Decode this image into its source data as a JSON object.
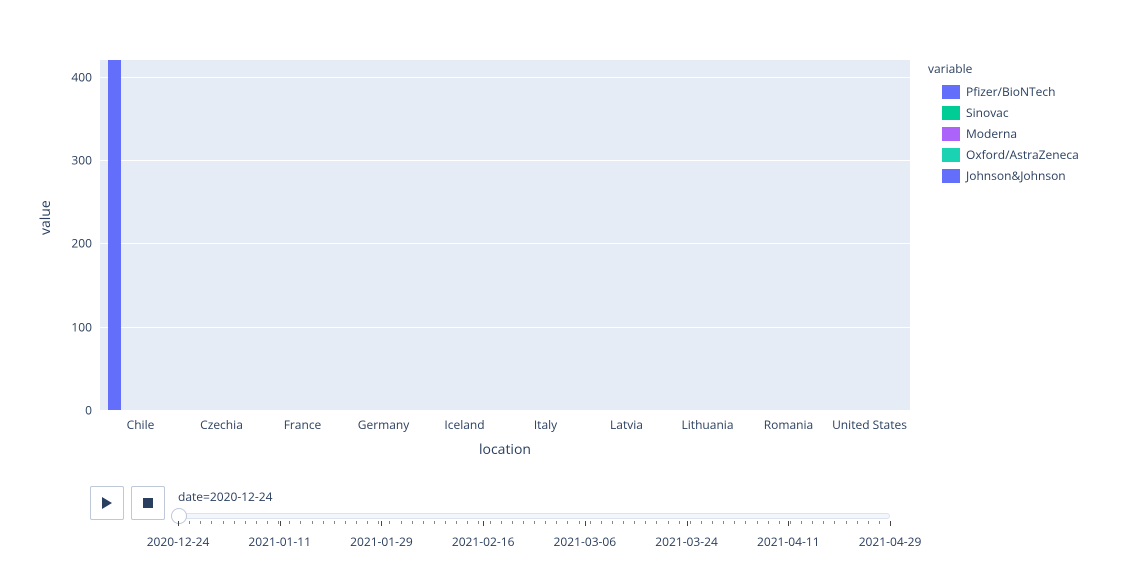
{
  "chart_data": {
    "type": "bar",
    "title": "",
    "xlabel": "location",
    "ylabel": "value",
    "categories": [
      "Chile",
      "Czechia",
      "France",
      "Germany",
      "Iceland",
      "Italy",
      "Latvia",
      "Lithuania",
      "Romania",
      "United States"
    ],
    "series": [
      {
        "name": "Pfizer/BioNTech",
        "values": [
          420,
          0,
          0,
          0,
          0,
          0,
          0,
          0,
          0,
          0
        ],
        "color": "#636efa"
      },
      {
        "name": "Sinovac",
        "values": [
          0,
          0,
          0,
          0,
          0,
          0,
          0,
          0,
          0,
          0
        ],
        "color": "#00cc96"
      },
      {
        "name": "Moderna",
        "values": [
          0,
          0,
          0,
          0,
          0,
          0,
          0,
          0,
          0,
          0
        ],
        "color": "#ab63fa"
      },
      {
        "name": "Oxford/AstraZeneca",
        "values": [
          0,
          0,
          0,
          0,
          0,
          0,
          0,
          0,
          0,
          0
        ],
        "color": "#19d3b3"
      },
      {
        "name": "Johnson&Johnson",
        "values": [
          0,
          0,
          0,
          0,
          0,
          0,
          0,
          0,
          0,
          0
        ],
        "color": "#636efa"
      }
    ],
    "y_ticks": [
      0,
      100,
      200,
      300,
      400
    ],
    "ylim": [
      0,
      420
    ]
  },
  "legend": {
    "title": "variable"
  },
  "animation": {
    "current_label": "date=2020-12-24",
    "tick_labels": [
      "2020-12-24",
      "2021-01-11",
      "2021-01-29",
      "2021-02-16",
      "2021-03-06",
      "2021-03-24",
      "2021-04-11",
      "2021-04-29"
    ]
  },
  "controls": {
    "play_icon": "play",
    "stop_icon": "stop"
  }
}
